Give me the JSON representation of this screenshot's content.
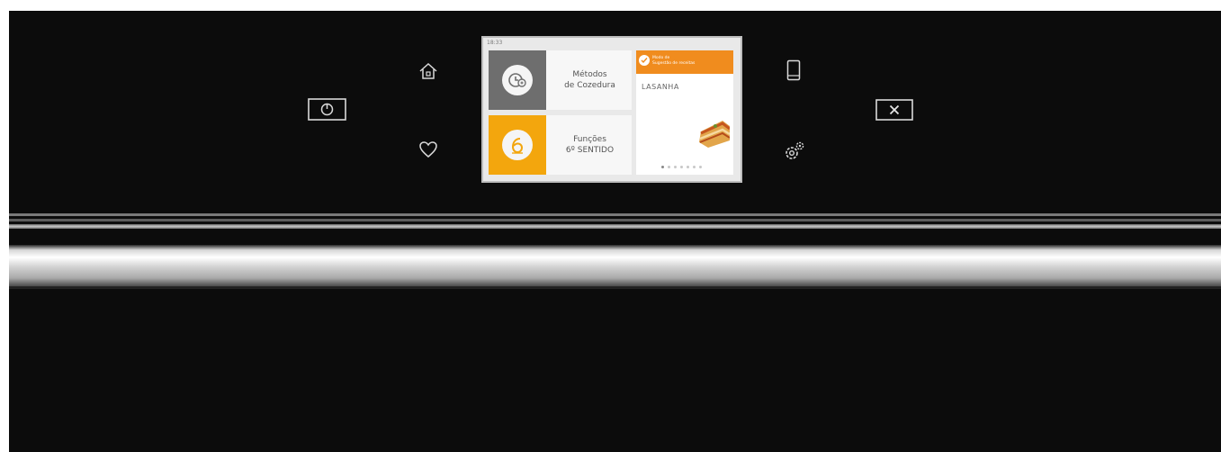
{
  "display": {
    "status_time": "18:33",
    "tiles": [
      {
        "line1": "Métodos",
        "line2": "de Cozedura",
        "icon": "clock-icon"
      },
      {
        "line1": "Funções",
        "line2": "6º SENTIDO",
        "icon": "sixth-sense-icon"
      }
    ],
    "recipe": {
      "banner_line1": "Modo de",
      "banner_line2": "Sugestão de receitas",
      "name": "LASANHA",
      "dots_total": 7,
      "dot_active": 1
    }
  },
  "keys": {
    "power": "power-icon",
    "home": "home-icon",
    "favorites": "heart-icon",
    "remote": "phone-icon",
    "settings": "gears-icon",
    "close": "close-icon"
  },
  "colors": {
    "panel": "#0c0c0c",
    "accent_orange": "#f08c1e",
    "accent_yellow": "#f3a60d",
    "tile_gray": "#6e6e6e"
  }
}
